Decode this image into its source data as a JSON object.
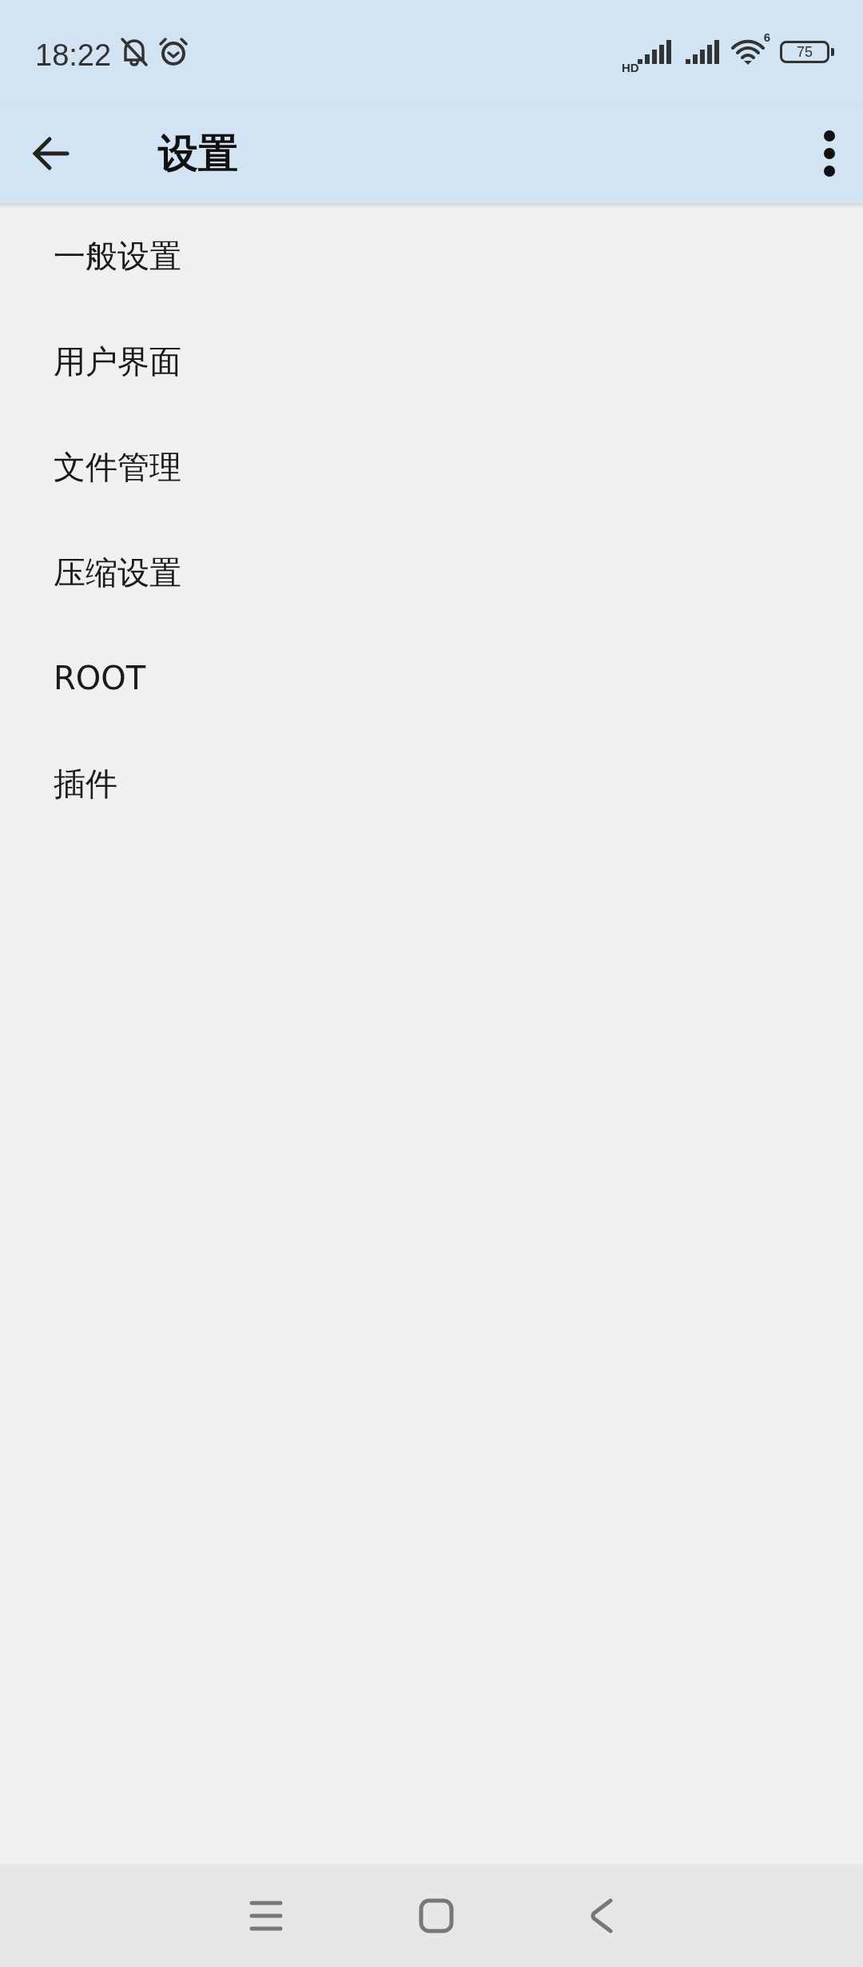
{
  "status_bar": {
    "time": "18:22",
    "network_label": "HD",
    "wifi_label": "6",
    "battery": "75"
  },
  "app_bar": {
    "title": "设置"
  },
  "items": [
    {
      "label": "一般设置"
    },
    {
      "label": "用户界面"
    },
    {
      "label": "文件管理"
    },
    {
      "label": "压缩设置"
    },
    {
      "label": "ROOT"
    },
    {
      "label": "插件"
    }
  ]
}
